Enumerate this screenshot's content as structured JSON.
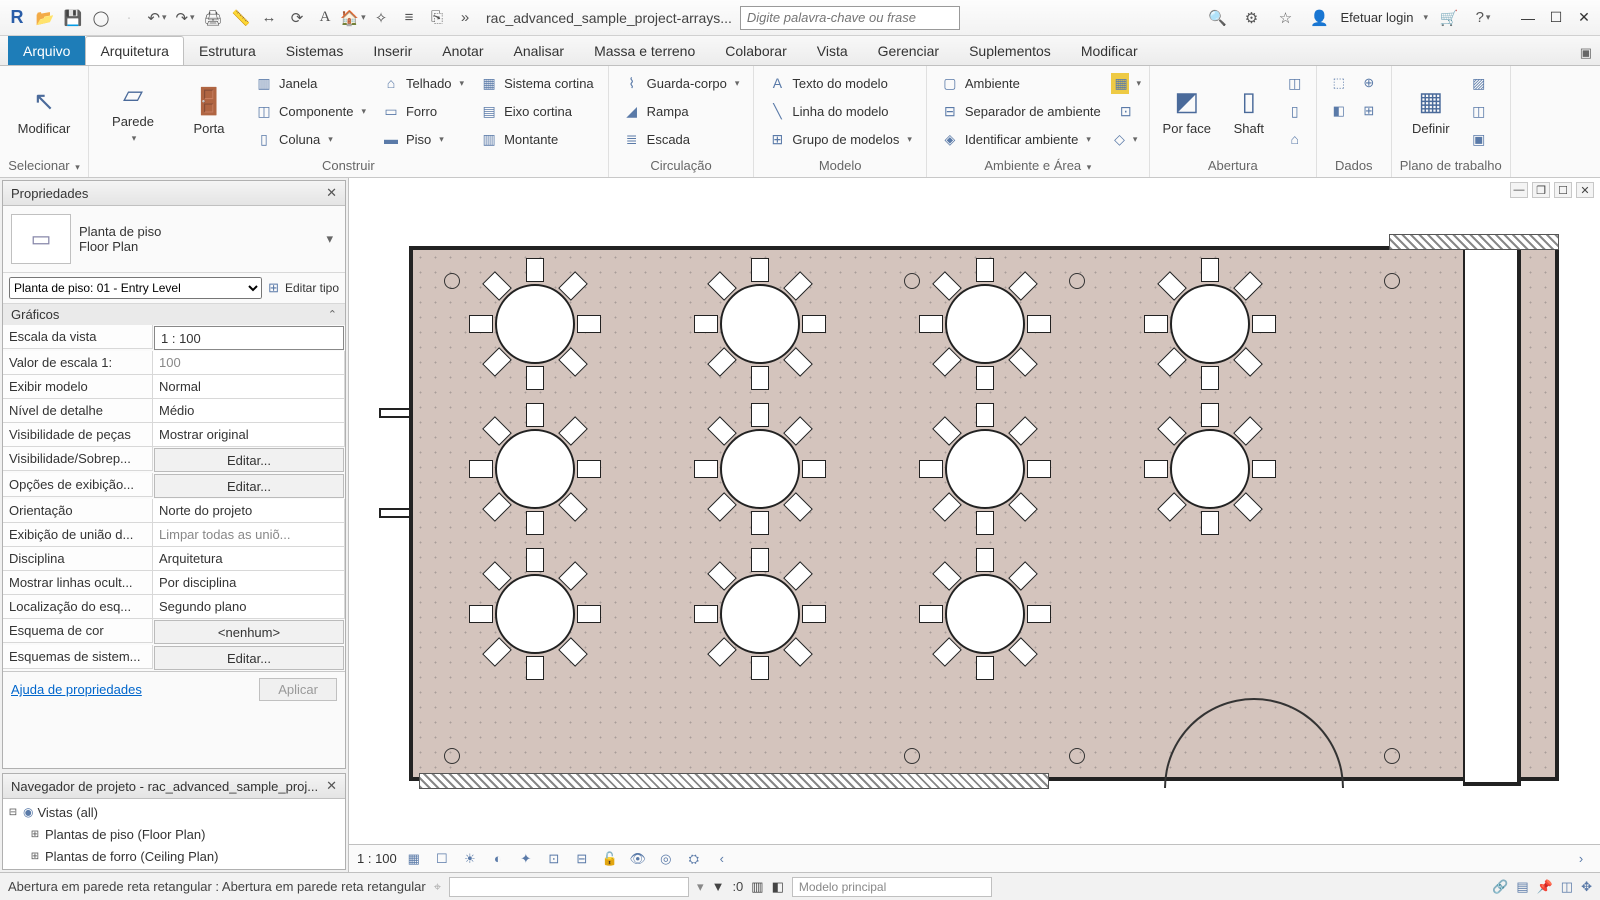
{
  "titlebar": {
    "doc_title": "rac_advanced_sample_project-arrays...",
    "search_placeholder": "Digite palavra-chave ou frase",
    "login_label": "Efetuar login"
  },
  "tabs": {
    "file": "Arquivo",
    "items": [
      "Arquitetura",
      "Estrutura",
      "Sistemas",
      "Inserir",
      "Anotar",
      "Analisar",
      "Massa e terreno",
      "Colaborar",
      "Vista",
      "Gerenciar",
      "Suplementos",
      "Modificar"
    ],
    "active_index": 0
  },
  "ribbon": {
    "select": {
      "modify": "Modificar",
      "group": "Selecionar"
    },
    "build": {
      "wall": "Parede",
      "door": "Porta",
      "window": "Janela",
      "component": "Componente",
      "column": "Coluna",
      "roof": "Telhado",
      "ceiling": "Forro",
      "floor": "Piso",
      "curtain_system": "Sistema  cortina",
      "curtain_grid": "Eixo  cortina",
      "mullion": "Montante",
      "group": "Construir"
    },
    "circ": {
      "railing": "Guarda-corpo",
      "ramp": "Rampa",
      "stair": "Escada",
      "group": "Circulação"
    },
    "model": {
      "text": "Texto do  modelo",
      "line": "Linha do  modelo",
      "group_btn": "Grupo de  modelos",
      "group": "Modelo"
    },
    "room": {
      "room_btn": "Ambiente",
      "sep": "Separador  de ambiente",
      "tag": "Identificar  ambiente",
      "group": "Ambiente e Área"
    },
    "opening": {
      "face": "Por face",
      "shaft": "Shaft",
      "group": "Abertura"
    },
    "datum": {
      "group": "Dados"
    },
    "workplane": {
      "set": "Definir",
      "group": "Plano de trabalho"
    }
  },
  "props": {
    "title": "Propriedades",
    "type_line1": "Planta de piso",
    "type_line2": "Floor Plan",
    "instance_select": "Planta de piso: 01 - Entry Level",
    "edit_type": "Editar tipo",
    "cat_graphics": "Gráficos",
    "rows": [
      {
        "k": "Escala da vista",
        "v": "1 : 100",
        "editable": true
      },
      {
        "k": "Valor de escala    1:",
        "v": "100",
        "dim": true
      },
      {
        "k": "Exibir modelo",
        "v": "Normal"
      },
      {
        "k": "Nível de detalhe",
        "v": "Médio"
      },
      {
        "k": "Visibilidade de peças",
        "v": "Mostrar original"
      },
      {
        "k": "Visibilidade/Sobrep...",
        "v": "Editar...",
        "btn": true
      },
      {
        "k": "Opções de exibição...",
        "v": "Editar...",
        "btn": true
      },
      {
        "k": "Orientação",
        "v": "Norte do projeto"
      },
      {
        "k": "Exibição de união d...",
        "v": "Limpar todas as uniõ...",
        "dim": true
      },
      {
        "k": "Disciplina",
        "v": "Arquitetura"
      },
      {
        "k": "Mostrar linhas ocult...",
        "v": "Por disciplina"
      },
      {
        "k": "Localização do esq...",
        "v": "Segundo plano"
      },
      {
        "k": "Esquema de cor",
        "v": "<nenhum>",
        "btn": true
      },
      {
        "k": "Esquemas de sistem...",
        "v": "Editar...",
        "btn": true
      }
    ],
    "help": "Ajuda de propriedades",
    "apply": "Aplicar"
  },
  "browser": {
    "title": "Navegador de projeto - rac_advanced_sample_proj...",
    "root": "Vistas (all)",
    "child1": "Plantas de piso (Floor Plan)",
    "child2": "Plantas de forro (Ceiling Plan)"
  },
  "viewbar": {
    "scale": "1 : 100"
  },
  "status": {
    "hint": "Abertura em parede reta retangular : Abertura em parede reta retangular",
    "zero": ":0",
    "workset": "Modelo principal"
  }
}
